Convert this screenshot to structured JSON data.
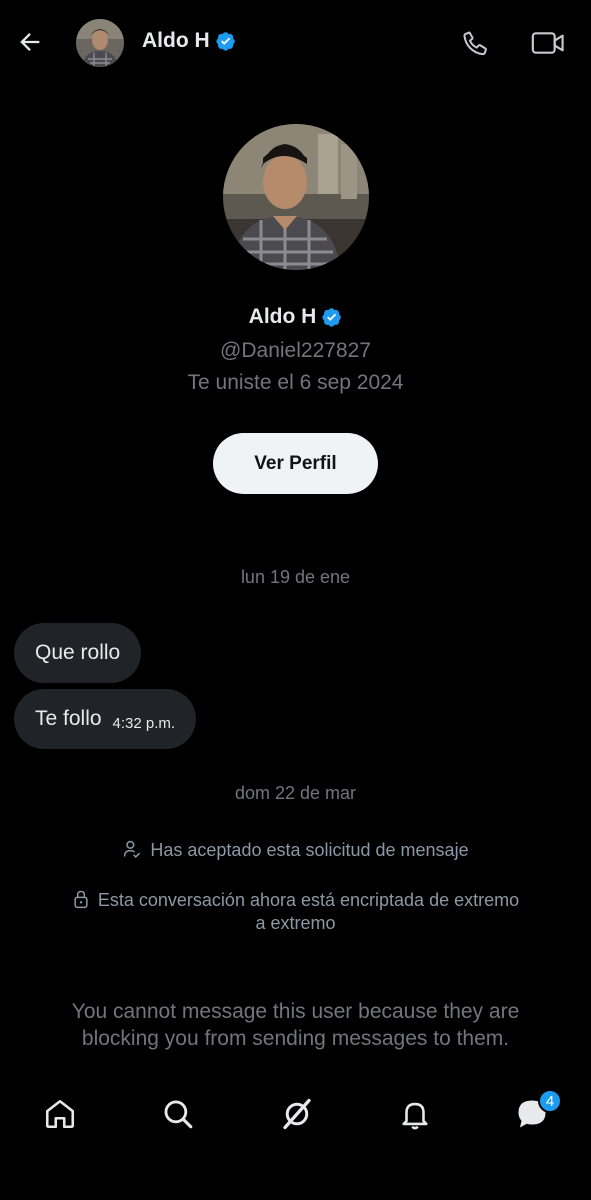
{
  "header": {
    "name": "Aldo H",
    "icons": {
      "back": "back-arrow-icon",
      "call": "phone-icon",
      "video": "video-camera-icon",
      "verified": "verified-badge-icon"
    }
  },
  "profile": {
    "name": "Aldo H",
    "handle": "@Daniel227827",
    "joined": "Te uniste el 6 sep 2024",
    "view_profile_label": "Ver Perfil"
  },
  "messages": {
    "date1": "lun 19 de ene",
    "items": [
      {
        "text": "Que rollo",
        "time": ""
      },
      {
        "text": "Te follo",
        "time": "4:32 p.m."
      }
    ],
    "date2": "dom 22 de mar",
    "system": [
      "Has aceptado esta solicitud de mensaje",
      "Esta conversación ahora está encriptada de extremo",
      "a extremo"
    ],
    "blocked_notice_line1": "You cannot message this user because they are",
    "blocked_notice_line2": "blocking you from sending messages to them."
  },
  "nav": {
    "items": [
      "home-icon",
      "search-icon",
      "grok-icon",
      "notifications-bell-icon",
      "messages-icon"
    ],
    "messages_badge": "4"
  },
  "colors": {
    "accent": "#1d9bf0",
    "background": "#000000",
    "bubble": "#202327"
  }
}
